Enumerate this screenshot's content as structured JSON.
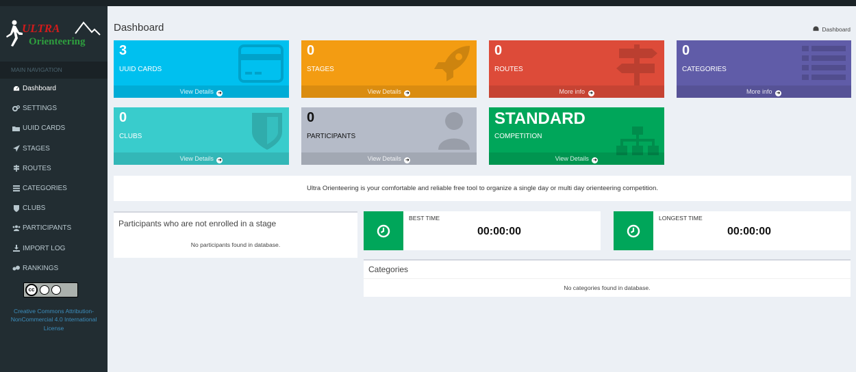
{
  "app": {
    "logo_text": "ULTRA Orienteering",
    "logo_top": "ULTRA",
    "logo_bottom": "Orienteering"
  },
  "sidebar": {
    "header": "MAIN NAVIGATION",
    "items": [
      {
        "label": "Dashboard",
        "icon": "dashboard-icon",
        "active": true
      },
      {
        "label": "SETTINGS",
        "icon": "gears-icon"
      },
      {
        "label": "UUID CARDS",
        "icon": "folder-icon"
      },
      {
        "label": "STAGES",
        "icon": "send-icon"
      },
      {
        "label": "ROUTES",
        "icon": "signpost-icon"
      },
      {
        "label": "CATEGORIES",
        "icon": "list-icon"
      },
      {
        "label": "CLUBS",
        "icon": "shield-icon"
      },
      {
        "label": "PARTICIPANTS",
        "icon": "users-icon"
      },
      {
        "label": "IMPORT LOG",
        "icon": "download-icon"
      },
      {
        "label": "RANKINGS",
        "icon": "podium-icon"
      }
    ],
    "license_badge": "cc BY NC",
    "license_link": "Creative Commons Attribution-NonCommercial 4.0 International License"
  },
  "header": {
    "title": "Dashboard",
    "breadcrumb": "Dashboard"
  },
  "boxes": [
    {
      "value": "3",
      "label": "UUID CARDS",
      "footer": "View Details",
      "color": "#00c0ef",
      "icon": "credit-card-icon"
    },
    {
      "value": "0",
      "label": "STAGES",
      "footer": "View Details",
      "color": "#f39c12",
      "icon": "rocket-icon"
    },
    {
      "value": "0",
      "label": "ROUTES",
      "footer": "More info",
      "color": "#dd4b39",
      "icon": "signpost-icon"
    },
    {
      "value": "0",
      "label": "CATEGORIES",
      "footer": "More info",
      "color": "#605ca8",
      "icon": "list-icon"
    },
    {
      "value": "0",
      "label": "CLUBS",
      "footer": "View Details",
      "color": "#39cccc",
      "icon": "shield-icon"
    },
    {
      "value": "0",
      "label": "PARTICIPANTS",
      "footer": "View Details",
      "color": "#b5bbc8",
      "icon": "user-icon"
    },
    {
      "value": "STANDARD",
      "label": "COMPETITION",
      "footer": "View Details",
      "color": "#00a65a",
      "icon": "sitemap-icon"
    }
  ],
  "info_text": "Ultra Orienteering is your comfortable and reliable free tool to organize a single day or multi day orienteering competition.",
  "not_enrolled": {
    "title": "Participants who are not enrolled in a stage",
    "empty": "No participants found in database."
  },
  "best_time": {
    "label": "BEST TIME",
    "value": "00:00:00"
  },
  "longest_time": {
    "label": "LONGEST TIME",
    "value": "00:00:00"
  },
  "categories_panel": {
    "title": "Categories",
    "empty": "No categories found in database."
  }
}
